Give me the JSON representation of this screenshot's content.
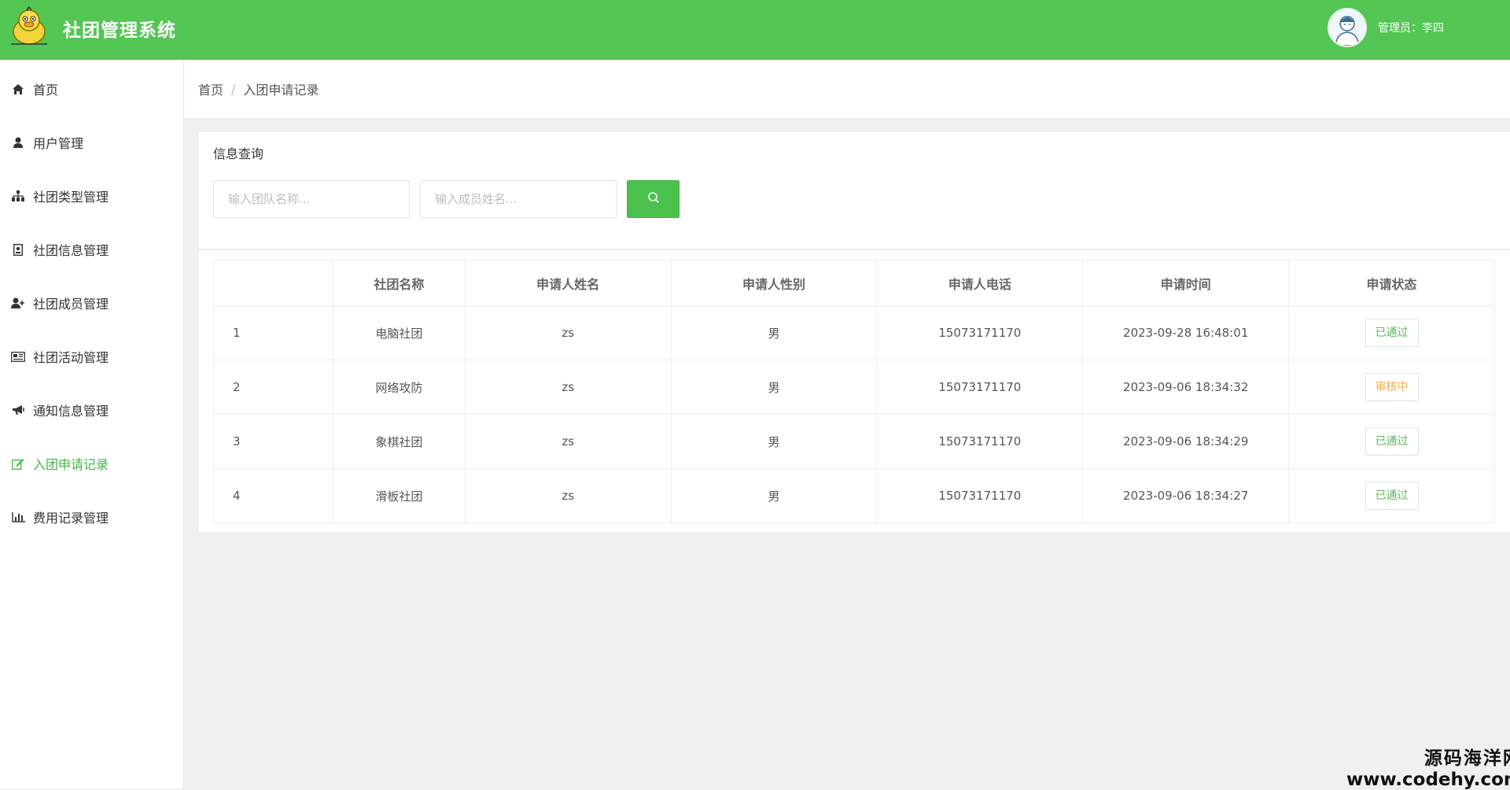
{
  "header": {
    "app_title": "社团管理系统",
    "admin_label": "管理员：李四",
    "logo_icon": "duck-mascot-icon",
    "avatar_icon": "user-avatar-icon",
    "bg_color": "#53c653"
  },
  "sidebar": {
    "items": [
      {
        "label": "首页",
        "icon": "home-icon"
      },
      {
        "label": "用户管理",
        "icon": "user-icon"
      },
      {
        "label": "社团类型管理",
        "icon": "sitemap-icon"
      },
      {
        "label": "社团信息管理",
        "icon": "id-badge-icon"
      },
      {
        "label": "社团成员管理",
        "icon": "user-plus-icon"
      },
      {
        "label": "社团活动管理",
        "icon": "newspaper-icon"
      },
      {
        "label": "通知信息管理",
        "icon": "bullhorn-icon"
      },
      {
        "label": "入团申请记录",
        "icon": "edit-icon",
        "active": true
      },
      {
        "label": "费用记录管理",
        "icon": "bar-chart-icon"
      }
    ],
    "active_color": "#3fb83f"
  },
  "breadcrumb": {
    "home": "首页",
    "separator": "/",
    "current": "入团申请记录"
  },
  "search": {
    "title": "信息查询",
    "team_placeholder": "输入团队名称...",
    "member_placeholder": "输入成员姓名...",
    "button_icon": "search-icon"
  },
  "table": {
    "columns": [
      "",
      "社团名称",
      "申请人姓名",
      "申请人性别",
      "申请人电话",
      "申请时间",
      "申请状态"
    ],
    "rows": [
      {
        "idx": "1",
        "club": "电脑社团",
        "name": "zs",
        "gender": "男",
        "phone": "15073171170",
        "time": "2023-09-28 16:48:01",
        "status": "已通过",
        "status_color": "#5cb85c"
      },
      {
        "idx": "2",
        "club": "网络攻防",
        "name": "zs",
        "gender": "男",
        "phone": "15073171170",
        "time": "2023-09-06 18:34:32",
        "status": "审核中",
        "status_color": "#f0ad4e"
      },
      {
        "idx": "3",
        "club": "象棋社团",
        "name": "zs",
        "gender": "男",
        "phone": "15073171170",
        "time": "2023-09-06 18:34:29",
        "status": "已通过",
        "status_color": "#5cb85c"
      },
      {
        "idx": "4",
        "club": "滑板社团",
        "name": "zs",
        "gender": "男",
        "phone": "15073171170",
        "time": "2023-09-06 18:34:27",
        "status": "已通过",
        "status_color": "#5cb85c"
      }
    ]
  },
  "watermark": {
    "line1": "源码海洋网",
    "line2": "www.codehy.com"
  }
}
